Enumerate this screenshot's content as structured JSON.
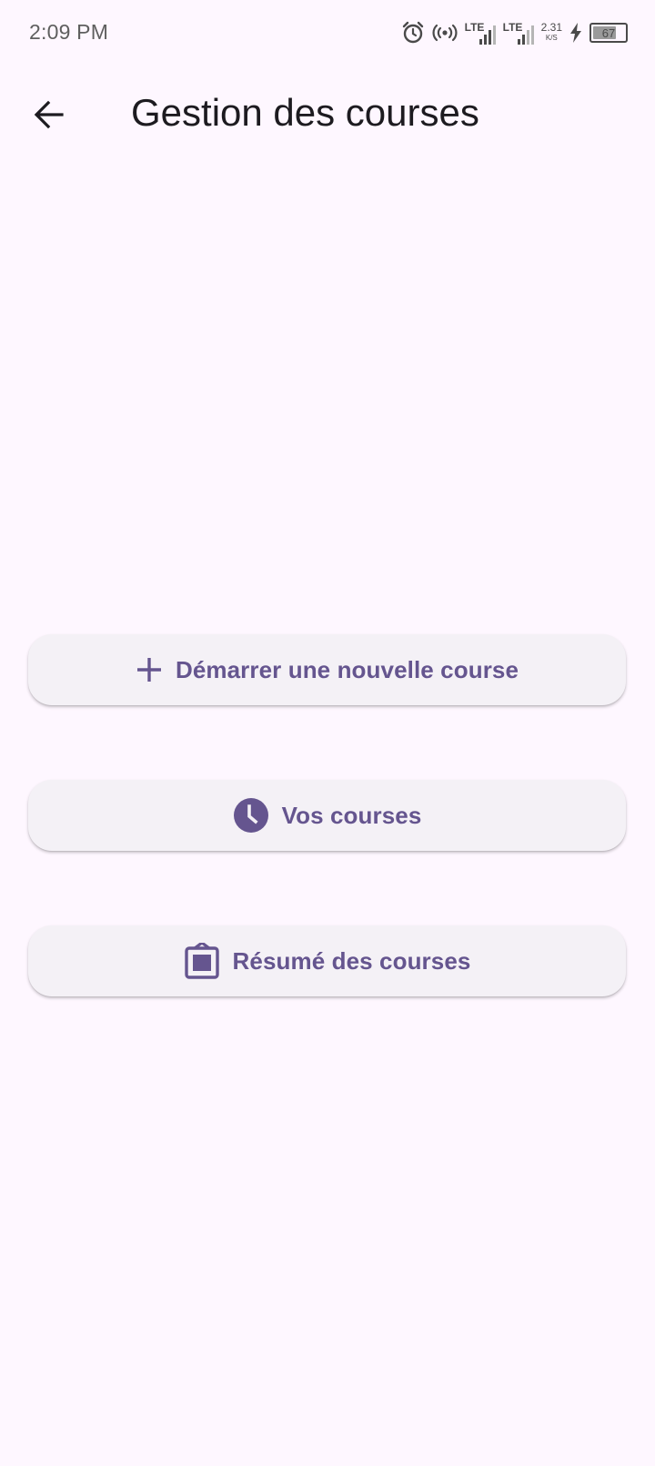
{
  "status_bar": {
    "time": "2:09 PM",
    "network_1": "LTE",
    "network_2": "LTE",
    "speed_value": "2.31",
    "speed_unit": "K/S",
    "battery": "67"
  },
  "app_bar": {
    "title": "Gestion des courses",
    "back_icon": "arrow-left-icon"
  },
  "actions": [
    {
      "label": "Démarrer une nouvelle course",
      "icon": "plus-icon"
    },
    {
      "label": "Vos courses",
      "icon": "clock-icon"
    },
    {
      "label": "Résumé des courses",
      "icon": "clipboard-icon"
    }
  ],
  "colors": {
    "background": "#FEF7FF",
    "accent": "#65558F",
    "button_bg": "#F4F1F6",
    "title": "#1D1B20"
  }
}
